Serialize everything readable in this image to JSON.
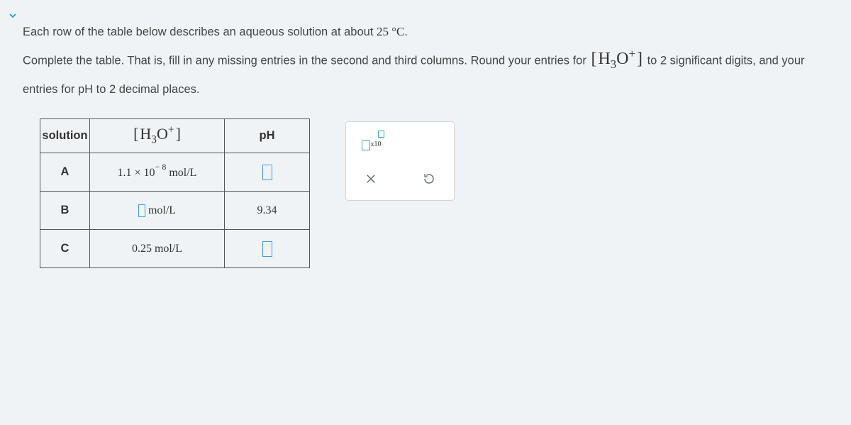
{
  "instructions": {
    "line1_pre": "Each row of the table below describes an aqueous solution at about ",
    "line1_temp": "25 °C",
    "line1_post": ".",
    "line2_pre": "Complete the table. That is, fill in any missing entries in the second and third columns. Round your entries for ",
    "line2_post": " to 2 significant digits, and your entries for pH to 2 decimal places."
  },
  "h3o_label_html": "H₃O⁺",
  "table": {
    "headers": {
      "solution": "solution",
      "h3o": "H₃O⁺",
      "ph": "pH"
    },
    "rows": [
      {
        "label": "A",
        "h3o_prefix": "1.1 × 10",
        "h3o_exp": "− 8",
        "h3o_unit": " mol/L",
        "ph": ""
      },
      {
        "label": "B",
        "h3o_prefix": "",
        "h3o_exp": "",
        "h3o_unit": " mol/L",
        "ph": "9.34"
      },
      {
        "label": "C",
        "h3o_prefix": "0.25 mol/L",
        "h3o_exp": "",
        "h3o_unit": "",
        "ph": ""
      }
    ]
  },
  "toolbox": {
    "sci_x10": "x10",
    "times": "×",
    "reset": "↺"
  }
}
